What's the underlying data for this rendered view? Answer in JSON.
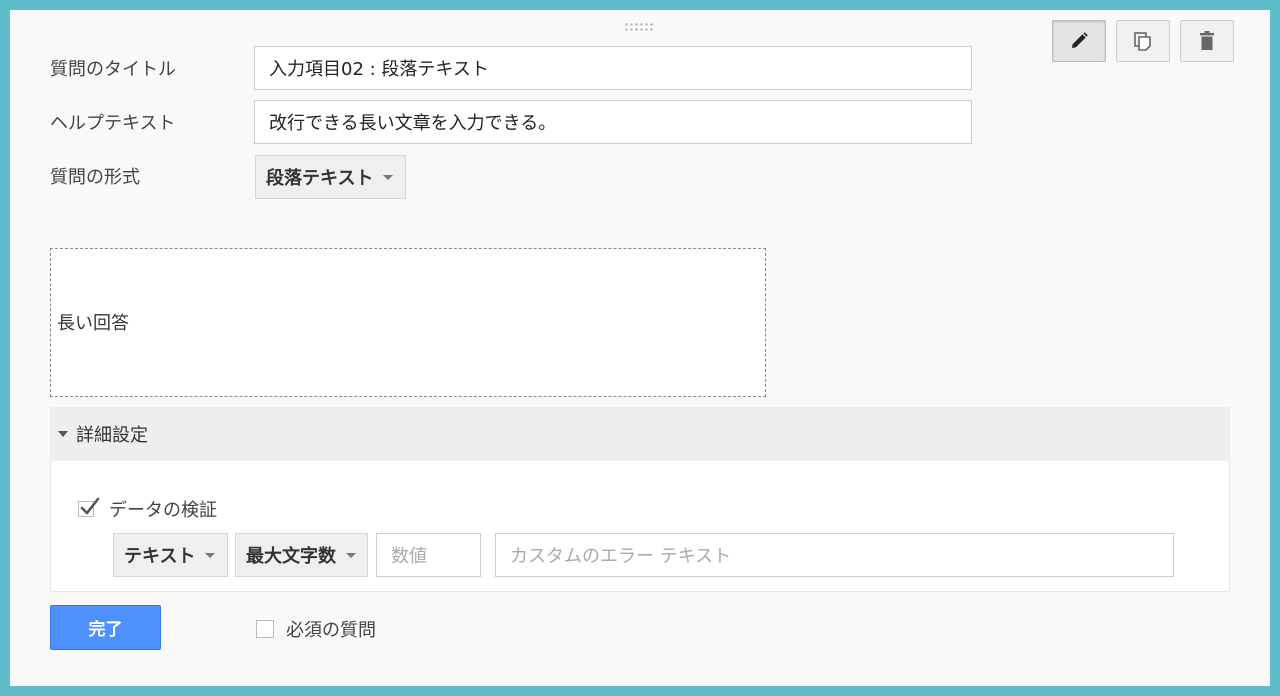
{
  "question": {
    "title_label": "質問のタイトル",
    "title_value": "入力項目02 : 段落テキスト",
    "help_label": "ヘルプテキスト",
    "help_value": "改行できる長い文章を入力できる。",
    "type_label": "質問の形式",
    "type_value": "段落テキスト"
  },
  "toolbar": {
    "edit_icon": "pencil-icon",
    "duplicate_icon": "duplicate-icon",
    "delete_icon": "trash-icon"
  },
  "preview": {
    "text": "長い回答"
  },
  "advanced": {
    "header": "詳細設定",
    "validation_label": "データの検証",
    "validation_checked": true,
    "type_option": "テキスト",
    "rule_option": "最大文字数",
    "number_placeholder": "数値",
    "error_placeholder": "カスタムのエラー テキスト"
  },
  "footer": {
    "done_label": "完了",
    "required_label": "必須の質問",
    "required_checked": false
  }
}
